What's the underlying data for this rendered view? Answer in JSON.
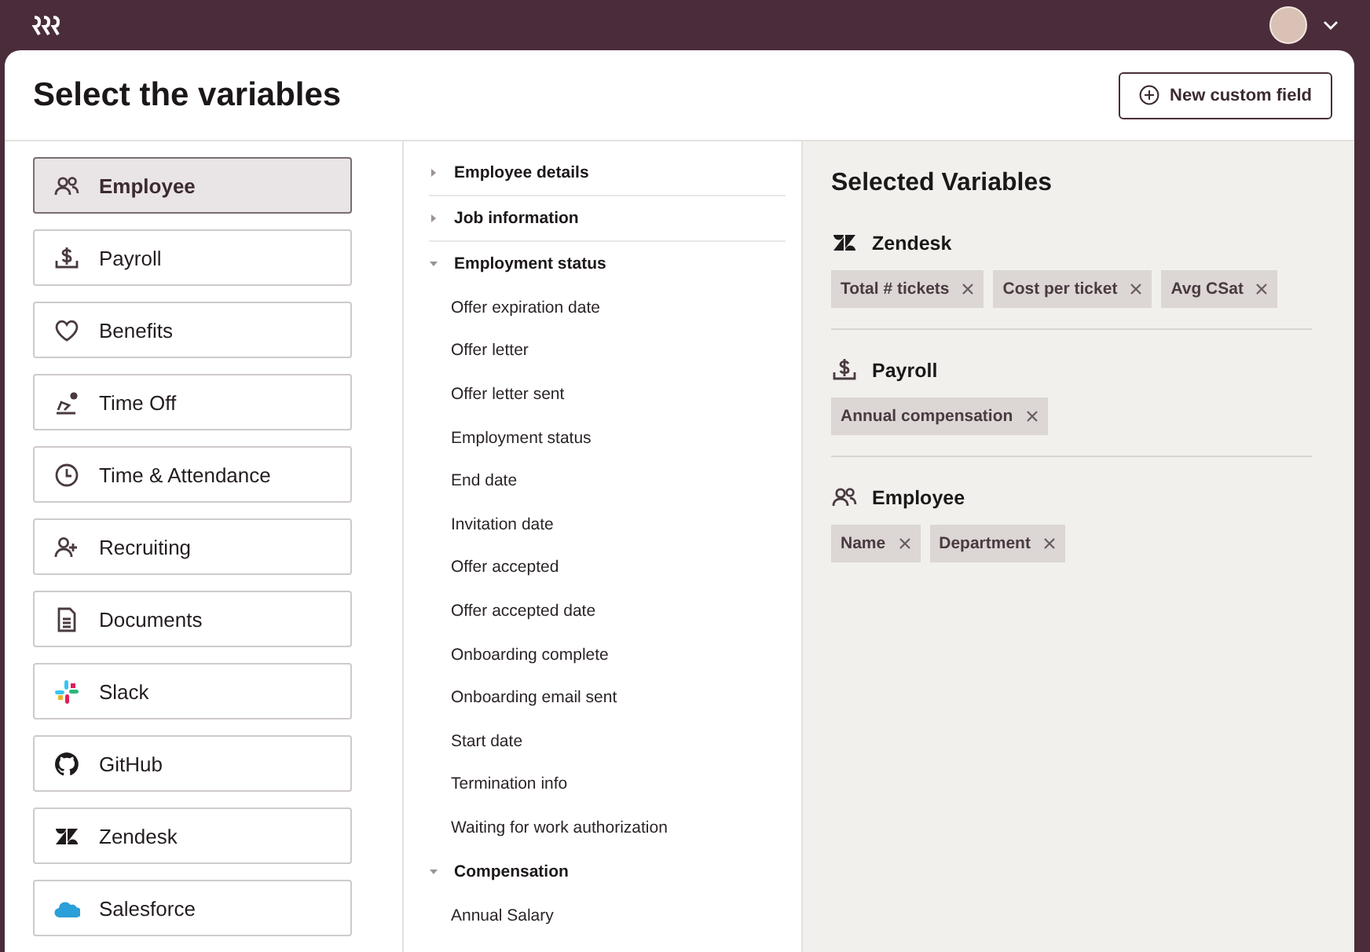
{
  "header": {
    "title": "Select the variables",
    "new_field_button": "New custom field"
  },
  "categories": [
    {
      "label": "Employee",
      "kind": "people",
      "selected": true
    },
    {
      "label": "Payroll",
      "kind": "payroll",
      "selected": false
    },
    {
      "label": "Benefits",
      "kind": "heart",
      "selected": false
    },
    {
      "label": "Time Off",
      "kind": "timeoff",
      "selected": false
    },
    {
      "label": "Time & Attendance",
      "kind": "clock",
      "selected": false
    },
    {
      "label": "Recruiting",
      "kind": "personadd",
      "selected": false
    },
    {
      "label": "Documents",
      "kind": "document",
      "selected": false
    },
    {
      "label": "Slack",
      "kind": "slack",
      "selected": false
    },
    {
      "label": "GitHub",
      "kind": "github",
      "selected": false
    },
    {
      "label": "Zendesk",
      "kind": "zendesk",
      "selected": false
    },
    {
      "label": "Salesforce",
      "kind": "cloud",
      "selected": false
    }
  ],
  "fields": [
    {
      "label": "Employee details",
      "expanded": false
    },
    {
      "label": "Job information",
      "expanded": false
    },
    {
      "label": "Employment status",
      "expanded": true,
      "children": [
        {
          "label": "Offer expiration date"
        },
        {
          "label": "Offer letter"
        },
        {
          "label": "Offer letter sent"
        },
        {
          "label": "Employment status"
        },
        {
          "label": "End date"
        },
        {
          "label": "Invitation date"
        },
        {
          "label": "Offer accepted"
        },
        {
          "label": "Offer accepted date"
        },
        {
          "label": "Onboarding complete"
        },
        {
          "label": "Onboarding email sent"
        },
        {
          "label": "Start date"
        },
        {
          "label": "Termination info"
        },
        {
          "label": "Waiting for work authorization"
        }
      ]
    },
    {
      "label": "Compensation",
      "expanded": true,
      "children": [
        {
          "label": "Annual Salary"
        }
      ]
    }
  ],
  "selected_variables": {
    "title": "Selected Variables",
    "groups": [
      {
        "name": "Zendesk",
        "kind": "zendesk",
        "variables": [
          "Total # tickets",
          "Cost per ticket",
          "Avg CSat"
        ]
      },
      {
        "name": "Payroll",
        "kind": "payroll",
        "variables": [
          "Annual compensation"
        ]
      },
      {
        "name": "Employee",
        "kind": "people",
        "variables": [
          "Name",
          "Department"
        ]
      }
    ]
  }
}
